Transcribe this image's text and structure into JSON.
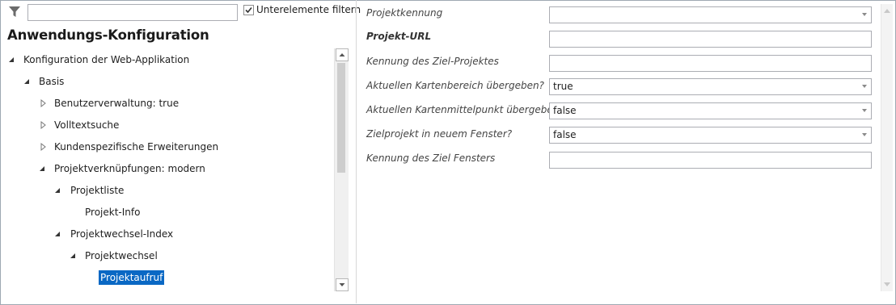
{
  "filter": {
    "icon": "funnel-icon",
    "value": "",
    "checkbox_checked": true,
    "checkbox_label": "Unterelemente filtern"
  },
  "tree": {
    "title": "Anwendungs-Konfiguration",
    "nodes": [
      {
        "label": "Konfiguration der Web-Applikation",
        "state": "expanded"
      },
      {
        "label": "Basis",
        "state": "expanded"
      },
      {
        "label": "Benutzerverwaltung: true",
        "state": "collapsed"
      },
      {
        "label": "Volltextsuche",
        "state": "collapsed"
      },
      {
        "label": "Kundenspezifische Erweiterungen",
        "state": "collapsed"
      },
      {
        "label": "Projektverknüpfungen: modern",
        "state": "expanded"
      },
      {
        "label": "Projektliste",
        "state": "expanded"
      },
      {
        "label": "Projekt-Info",
        "state": "leaf"
      },
      {
        "label": "Projektwechsel-Index",
        "state": "expanded"
      },
      {
        "label": "Projektwechsel",
        "state": "expanded"
      },
      {
        "label": "Projektaufruf",
        "state": "leaf",
        "selected": true
      }
    ]
  },
  "properties": [
    {
      "label": "Projektkennung",
      "value": "",
      "control": "dropdown",
      "bold": false
    },
    {
      "label": "Projekt-URL",
      "value": "",
      "control": "text",
      "bold": true
    },
    {
      "label": "Kennung des Ziel-Projektes",
      "value": "",
      "control": "text",
      "bold": false
    },
    {
      "label": "Aktuellen Kartenbereich übergeben?",
      "value": "true",
      "control": "dropdown",
      "bold": false
    },
    {
      "label": "Aktuellen Kartenmittelpunkt übergeben?",
      "value": "false",
      "control": "dropdown",
      "bold": false
    },
    {
      "label": "Zielprojekt in neuem Fenster?",
      "value": "false",
      "control": "dropdown",
      "bold": false
    },
    {
      "label": "Kennung des Ziel Fensters",
      "value": "",
      "control": "text",
      "bold": false
    }
  ],
  "colors": {
    "selection": "#0a68c4",
    "border": "#abadb3"
  }
}
